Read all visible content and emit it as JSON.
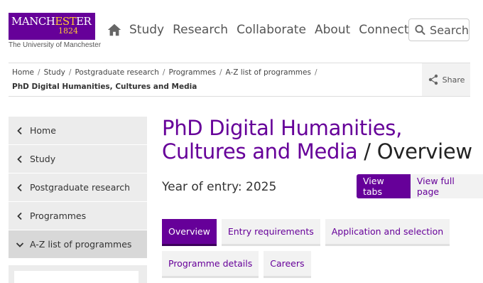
{
  "header": {
    "logo": {
      "word_a": "MANCH",
      "word_b": "EST",
      "word_c": "ER",
      "year": "1824",
      "subtitle": "The University of Manchester"
    },
    "nav": [
      "Study",
      "Research",
      "Collaborate",
      "About",
      "Connect"
    ],
    "search_label": "Search"
  },
  "breadcrumb": {
    "items": [
      "Home",
      "Study",
      "Postgraduate research",
      "Programmes",
      "A-Z list of programmes"
    ],
    "separator": "/",
    "current": "PhD Digital Humanities, Cultures and Media",
    "share_label": "Share"
  },
  "sidebar": {
    "items": [
      {
        "label": "Home",
        "active": false
      },
      {
        "label": "Study",
        "active": false
      },
      {
        "label": "Postgraduate research",
        "active": false
      },
      {
        "label": "Programmes",
        "active": false
      },
      {
        "label": "A-Z list of programmes",
        "active": true
      }
    ]
  },
  "main": {
    "title": "PhD Digital Humanities, Cultures and Media",
    "title_sep": " / ",
    "title_suffix": "Overview",
    "year_of_entry": "Year of entry: 2025",
    "view_tabs_label": "View tabs",
    "view_full_label": "View full page",
    "tabs_row1": [
      "Overview",
      "Entry requirements",
      "Application and selection"
    ],
    "tabs_row2": [
      "Programme details",
      "Careers"
    ]
  },
  "colors": {
    "brand_purple": "#660099",
    "brand_gold": "#ffcc33"
  }
}
